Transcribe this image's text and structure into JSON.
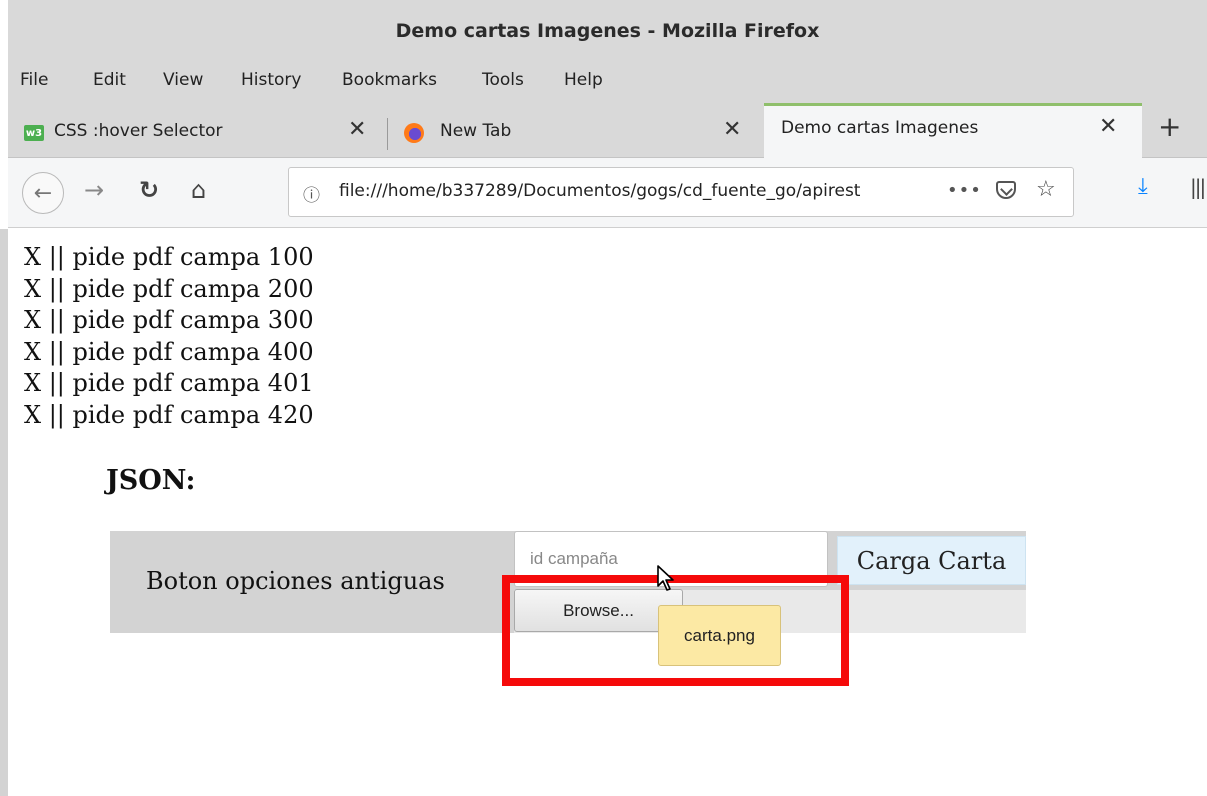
{
  "window": {
    "title": "Demo cartas Imagenes - Mozilla Firefox"
  },
  "menu": [
    "File",
    "Edit",
    "View",
    "History",
    "Bookmarks",
    "Tools",
    "Help"
  ],
  "tabs": [
    {
      "label": "CSS :hover Selector",
      "icon": "w3schools-icon"
    },
    {
      "label": "New Tab",
      "icon": "firefox-icon"
    },
    {
      "label": "Demo cartas Imagenes",
      "active": true
    }
  ],
  "nav": {
    "url": "file:///home/b337289/Documentos/gogs/cd_fuente_go/apirest"
  },
  "page": {
    "lines": [
      "X || pide pdf campa 100",
      "X || pide pdf campa 200",
      "X || pide pdf campa 300",
      "X || pide pdf campa 400",
      "X || pide pdf campa 401",
      "X || pide pdf campa 420"
    ],
    "json_heading": "JSON:",
    "panel_label": "Boton opciones antiguas",
    "id_placeholder": "id campaña",
    "carga_button": "Carga Carta",
    "browse_button": "Browse...",
    "file_tooltip": "carta.png"
  },
  "colors": {
    "highlight": "#f50a0a",
    "tooltip_bg": "#fce9a4",
    "carga_bg": "#e2f1fb",
    "active_tab_accent": "#8fbf6b"
  }
}
